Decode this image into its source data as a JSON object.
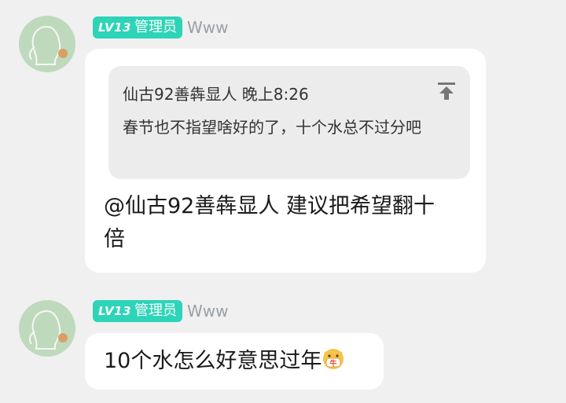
{
  "messages": [
    {
      "badge_level": "LV13",
      "badge_role": "管理员",
      "username": "Www",
      "quote": {
        "author_time": "仙古92善犇显人 晚上8:26",
        "text": "春节也不指望啥好的了，十个水总不过分吧"
      },
      "text_line1": "@仙古92善犇显人 建议把希望翻十",
      "text_line2": "倍"
    },
    {
      "badge_level": "LV13",
      "badge_role": "管理员",
      "username": "Www",
      "text": "10个水怎么好意思过年",
      "emoji": "cow-face-mask-emoji"
    }
  ],
  "colors": {
    "background": "#f0f0f0",
    "badge": "#2ed4b8",
    "bubble": "#ffffff",
    "quote_bg": "#ececec",
    "username": "#9aa0a6"
  },
  "icons": {
    "avatar": "avatar-sketch",
    "quote_jump": "jump-to-top-icon"
  }
}
